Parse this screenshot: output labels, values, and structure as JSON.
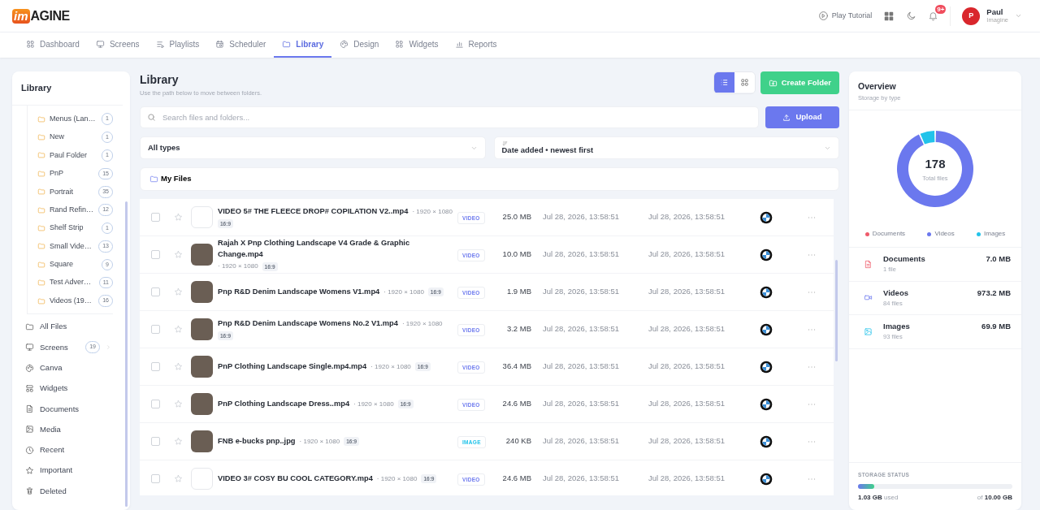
{
  "header": {
    "logo": {
      "mark": "im",
      "word": "AGINE"
    },
    "tutorial": "Play Tutorial",
    "notifications": "9+",
    "user": {
      "initial": "P",
      "name": "Paul",
      "org": "Imagine"
    }
  },
  "nav": [
    {
      "label": "Dashboard",
      "selected": false
    },
    {
      "label": "Screens",
      "selected": false
    },
    {
      "label": "Playlists",
      "selected": false
    },
    {
      "label": "Scheduler",
      "selected": false
    },
    {
      "label": "Library",
      "selected": true
    },
    {
      "label": "Design",
      "selected": false
    },
    {
      "label": "Widgets",
      "selected": false
    },
    {
      "label": "Reports",
      "selected": false
    }
  ],
  "sidebar": {
    "title": "Library",
    "folders": [
      {
        "name": "Menus (Lan…",
        "count": "1"
      },
      {
        "name": "New",
        "count": "1"
      },
      {
        "name": "Paul Folder",
        "count": "1"
      },
      {
        "name": "PnP",
        "count": "15"
      },
      {
        "name": "Portrait",
        "count": "35"
      },
      {
        "name": "Rand Refin…",
        "count": "12"
      },
      {
        "name": "Shelf Strip",
        "count": "1"
      },
      {
        "name": "Small Vide…",
        "count": "13"
      },
      {
        "name": "Square",
        "count": "9"
      },
      {
        "name": "Test Adver…",
        "count": "11"
      },
      {
        "name": "Videos (19…",
        "count": "16"
      }
    ],
    "items": [
      {
        "label": "All Files",
        "expandable": false
      },
      {
        "label": "Screens",
        "count": "19",
        "expandable": true
      },
      {
        "label": "Canva",
        "expandable": false
      },
      {
        "label": "Widgets",
        "expandable": false
      },
      {
        "label": "Documents",
        "expandable": false
      },
      {
        "label": "Media",
        "expandable": false
      },
      {
        "label": "Recent",
        "expandable": false
      },
      {
        "label": "Important",
        "expandable": false
      },
      {
        "label": "Deleted",
        "expandable": false
      }
    ]
  },
  "main": {
    "title": "Library",
    "subtitle": "Use the path below to move between folders.",
    "views": [
      {
        "selected": true
      },
      {
        "selected": false
      }
    ],
    "create_button": "Create Folder",
    "search": {
      "placeholder": "Search files and folders..."
    },
    "upload_button": "Upload",
    "type_filter": "All types",
    "sort": "Date added • newest first",
    "breadcrumb": "My Files",
    "files": [
      {
        "checked": false,
        "name": "VIDEO 5# THE FLEECE DROP# COPILATION V2..mp4",
        "resolution": "· 1920 × 1080",
        "ratio": "16:9",
        "kind": "video",
        "type": "VIDEO",
        "size": "25.0 MB",
        "created": "Jul 28, 2026, 13:58:51",
        "modified": "Jul 28, 2026, 13:58:51"
      },
      {
        "checked": false,
        "name": "Rajah X Pnp Clothing Landscape V4 Grade & Graphic Change.mp4",
        "resolution": "· 1920 × 1080",
        "ratio": "16:9",
        "kind": "video",
        "type": "VIDEO",
        "size": "10.0 MB",
        "created": "Jul 28, 2026, 13:58:51",
        "modified": "Jul 28, 2026, 13:58:51"
      },
      {
        "checked": false,
        "name": "Pnp R&D Denim Landscape Womens V1.mp4",
        "resolution": "· 1920 × 1080",
        "ratio": "16:9",
        "kind": "video",
        "type": "VIDEO",
        "size": "1.9 MB",
        "created": "Jul 28, 2026, 13:58:51",
        "modified": "Jul 28, 2026, 13:58:51"
      },
      {
        "checked": false,
        "name": "Pnp R&D Denim Landscape Womens No.2 V1.mp4",
        "resolution": "· 1920 × 1080",
        "ratio": "16:9",
        "kind": "video",
        "type": "VIDEO",
        "size": "3.2 MB",
        "created": "Jul 28, 2026, 13:58:51",
        "modified": "Jul 28, 2026, 13:58:51"
      },
      {
        "checked": false,
        "name": "PnP Clothing Landscape Single.mp4.mp4",
        "resolution": "· 1920 × 1080",
        "ratio": "16:9",
        "kind": "video",
        "type": "VIDEO",
        "size": "36.4 MB",
        "created": "Jul 28, 2026, 13:58:51",
        "modified": "Jul 28, 2026, 13:58:51"
      },
      {
        "checked": false,
        "name": "PnP Clothing Landscape Dress..mp4",
        "resolution": "· 1920 × 1080",
        "ratio": "16:9",
        "kind": "video",
        "type": "VIDEO",
        "size": "24.6 MB",
        "created": "Jul 28, 2026, 13:58:51",
        "modified": "Jul 28, 2026, 13:58:51"
      },
      {
        "checked": false,
        "name": "FNB e-bucks pnp..jpg",
        "resolution": "· 1920 × 1080",
        "ratio": "16:9",
        "kind": "image",
        "type": "IMAGE",
        "size": "240 KB",
        "created": "Jul 28, 2026, 13:58:51",
        "modified": "Jul 28, 2026, 13:58:51"
      },
      {
        "checked": false,
        "name": "VIDEO 3# COSY BU COOL CATEGORY.mp4",
        "resolution": "· 1920 × 1080",
        "ratio": "16:9",
        "kind": "video",
        "type": "VIDEO",
        "size": "24.6 MB",
        "created": "Jul 28, 2026, 13:58:51",
        "modified": "Jul 28, 2026, 13:58:51"
      }
    ]
  },
  "overview": {
    "title": "Overview",
    "subtitle": "Storage by type",
    "total": "178",
    "total_label": "Total files",
    "chart_data": {
      "type": "donut",
      "categories": [
        "Documents",
        "Videos",
        "Images"
      ],
      "values": [
        null,
        92.67,
        6.66
      ]
    },
    "legend": [
      {
        "color": "#ef5b6b"
      },
      {
        "color": "#6b78ee"
      },
      {
        "color": "#22c3ea"
      }
    ],
    "types": [
      {
        "name": "Documents",
        "files": "1 file",
        "size": "7.0 MB"
      },
      {
        "name": "Videos",
        "files": "84 files",
        "size": "973.2 MB"
      },
      {
        "name": "Images",
        "files": "93 files",
        "size": "69.9 MB"
      }
    ],
    "storage": {
      "label": "STORAGE STATUS",
      "level": 0.103,
      "used": "**1.03 GB** used",
      "total": "of **10.00 GB**"
    }
  }
}
